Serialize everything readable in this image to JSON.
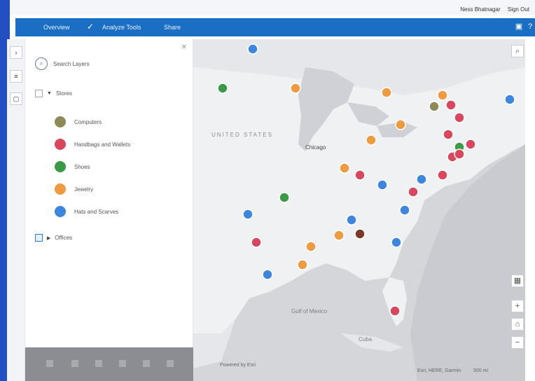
{
  "header": {
    "user_name": "Ness Bhatnagar",
    "sign_out": "Sign Out"
  },
  "appbar": {
    "crumb_home": "Overview",
    "crumb_current": "Analyze Tools",
    "crumb_share": "Share",
    "color": "#1a6fc4"
  },
  "panel": {
    "search_label": "Search Layers",
    "group_stores": "Stores",
    "group_offices": "Offices",
    "legend": [
      {
        "label": "Computers",
        "color": "#8d8a57"
      },
      {
        "label": "Handbags and Wallets",
        "color": "#d9475e"
      },
      {
        "label": "Shoes",
        "color": "#3a9a46"
      },
      {
        "label": "Jewelry",
        "color": "#ef9a3e"
      },
      {
        "label": "Hats and Scarves",
        "color": "#3c86e0"
      }
    ]
  },
  "map": {
    "country_label": "UNITED STATES",
    "city_chicago": "Chicago",
    "gulf_label": "Gulf of Mexico",
    "cuba_label": "Cuba",
    "attribution": "Esri, HERE, Garmin",
    "powered_by": "Powered by Esri",
    "scale_label": "500 mi",
    "controls": {
      "zoom_in": "+",
      "zoom_out": "−",
      "home": "⌂",
      "search": "⌕",
      "basemap": "▦"
    }
  }
}
